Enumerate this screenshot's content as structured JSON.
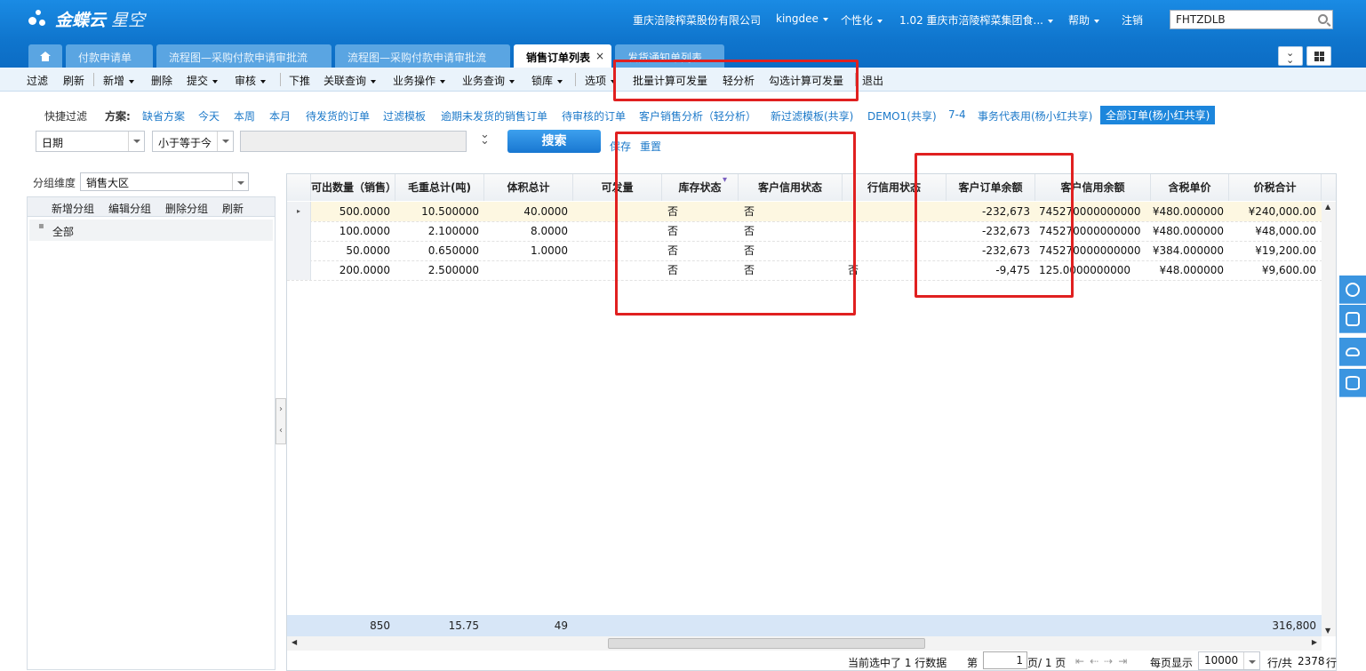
{
  "app": {
    "brand": "金蝶云",
    "brand_sub": "星空"
  },
  "header": {
    "company": "重庆涪陵榨菜股份有限公司",
    "user": "kingdee",
    "personalize": "个性化",
    "org": "1.02  重庆市涪陵榨菜集团食...",
    "help": "帮助",
    "logout": "注销",
    "search_value": "FHTZDLB"
  },
  "tabs": [
    {
      "label": "付款申请单"
    },
    {
      "label": "流程图—采购付款申请审批流"
    },
    {
      "label": "流程图—采购付款申请审批流"
    },
    {
      "label": "销售订单列表",
      "active": true,
      "close": "×"
    },
    {
      "label": "发货通知单列表"
    }
  ],
  "toolbar": {
    "filter": "过滤",
    "refresh": "刷新",
    "new": "新增",
    "delete": "删除",
    "submit": "提交",
    "audit": "审核",
    "push": "下推",
    "related": "关联查询",
    "biz_op": "业务操作",
    "biz_query": "业务查询",
    "lock": "锁库",
    "options": "选项",
    "batch_calc": "批量计算可发量",
    "light_analysis": "轻分析",
    "check_calc": "勾选计算可发量",
    "exit": "退出"
  },
  "quick_filter": {
    "label": "快捷过滤",
    "scheme_label": "方案:",
    "schemes": [
      "缺省方案",
      "今天",
      "本周",
      "本月",
      "待发货的订单",
      "过滤模板",
      "逾期未发货的销售订单",
      "待审核的订单",
      "客户销售分析（轻分析）",
      "新过滤模板(共享)",
      "DEMO1(共享)",
      "7-4",
      "事务代表用(杨小红共享)",
      "全部订单(杨小红共享)"
    ],
    "active_scheme": "全部订单(杨小红共享)"
  },
  "filter_row": {
    "field": "日期",
    "operator": "小于等于今",
    "value": "",
    "search": "搜索",
    "save": "保存",
    "reset": "重置"
  },
  "group_panel": {
    "dim_label": "分组维度",
    "dim_value": "销售大区",
    "add": "新增分组",
    "edit": "编辑分组",
    "delete": "删除分组",
    "refresh": "刷新",
    "tree_root": "全部"
  },
  "grid": {
    "columns": [
      "可出数量（销售）",
      "毛重总计(吨)",
      "体积总计",
      "可发量",
      "库存状态",
      "客户信用状态",
      "行信用状态",
      "客户订单余额",
      "客户信用余额",
      "含税单价",
      "价税合计"
    ],
    "rows": [
      [
        "500.0000",
        "10.500000",
        "40.0000",
        "",
        "否",
        "否",
        "",
        "-232,673",
        "745270000000000",
        "¥480.000000",
        "¥240,000.00"
      ],
      [
        "100.0000",
        "2.100000",
        "8.0000",
        "",
        "否",
        "否",
        "",
        "-232,673",
        "745270000000000",
        "¥480.000000",
        "¥48,000.00"
      ],
      [
        "50.0000",
        "0.650000",
        "1.0000",
        "",
        "否",
        "否",
        "",
        "-232,673",
        "745270000000000",
        "¥384.000000",
        "¥19,200.00"
      ],
      [
        "200.0000",
        "2.500000",
        "",
        "",
        "否",
        "否",
        "否",
        "-9,475",
        "125.0000000000",
        "¥48.000000",
        "¥9,600.00"
      ]
    ],
    "totals": [
      "850",
      "15.75",
      "49",
      "316,800"
    ]
  },
  "pager": {
    "selected_text": "当前选中了 1 行数据",
    "page_label": "第",
    "page": "1",
    "page_of": "页/ 1 页",
    "per_page_label": "每页显示",
    "per_page": "10000",
    "total_label": "行/共",
    "total": "2378",
    "rows_unit": "行"
  },
  "colors": {
    "accent": "#0f75cd",
    "highlight": "#e02020",
    "link": "#1c79c9"
  }
}
